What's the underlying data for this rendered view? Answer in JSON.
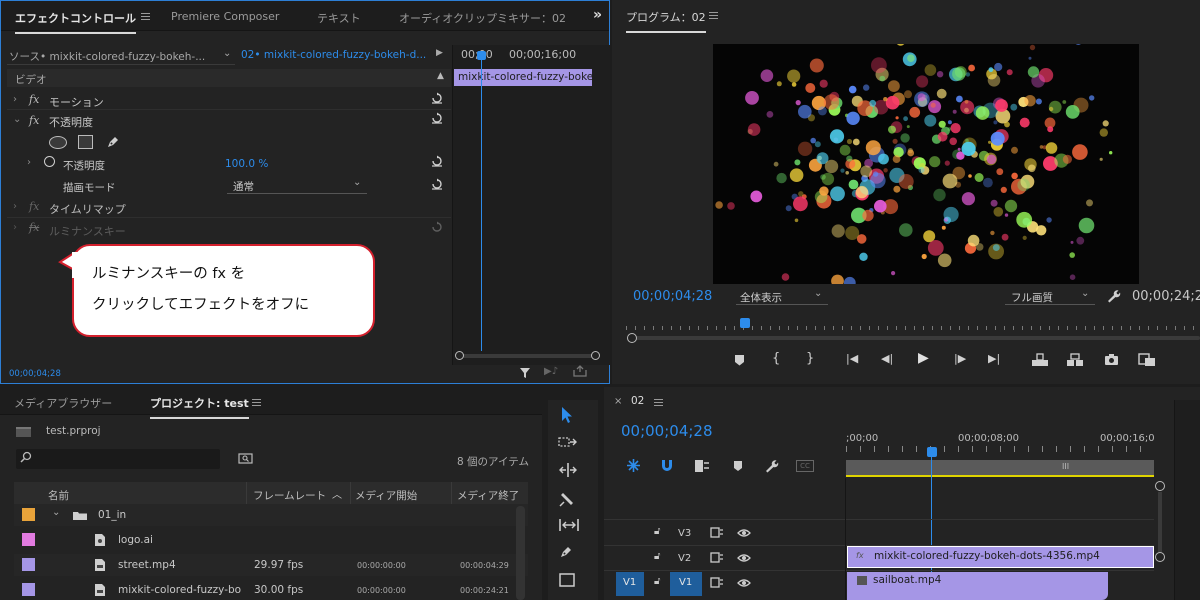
{
  "effect_controls": {
    "tabs": [
      "エフェクトコントロール",
      "Premiere Composer",
      "テキスト",
      "オーディオクリップミキサー：02"
    ],
    "source_label": "ソース• mixkit-colored-fuzzy-bokeh-...",
    "seq_label": "02• mixkit-colored-fuzzy-bokeh-d...",
    "ruler_t1": "00;00",
    "ruler_t2": "00;00;16;00",
    "clip_label": "mixkit-colored-fuzzy-boke",
    "section_video": "ビデオ",
    "effects": {
      "motion": "モーション",
      "opacity": "不透明度",
      "opacity_param": "不透明度",
      "opacity_value": "100.0 %",
      "blend_mode_label": "描画モード",
      "blend_mode_value": "通常",
      "time_remap": "タイムリマップ",
      "luma_key": "ルミナンスキー"
    },
    "timecode": "00;00;04;28"
  },
  "callout": {
    "line1": "ルミナンスキーの fx を",
    "line2": "クリックしてエフェクトをオフに"
  },
  "program": {
    "title": "プログラム：02",
    "timecode": "00;00;04;28",
    "zoom": "全体表示",
    "quality": "フル画質",
    "duration": "00;00;24;2"
  },
  "project": {
    "tabs": [
      "メディアブラウザー",
      "プロジェクト: test"
    ],
    "file": "test.prproj",
    "count": "8 個のアイテム",
    "columns": [
      "名前",
      "フレームレート",
      "メディア開始",
      "メディア終了"
    ],
    "rows": [
      {
        "name": "01_in",
        "fps": "",
        "start": "",
        "end": "",
        "color": "#e8a33a",
        "kind": "folder"
      },
      {
        "name": "logo.ai",
        "fps": "",
        "start": "",
        "end": "",
        "color": "#e27be0",
        "kind": "image"
      },
      {
        "name": "street.mp4",
        "fps": "29.97 fps",
        "start": "00:00:00:00",
        "end": "00:00:04:29",
        "color": "#a596e6",
        "kind": "video"
      },
      {
        "name": "mixkit-colored-fuzzy-bo",
        "fps": "30.00 fps",
        "start": "00:00:00:00",
        "end": "00:00:24:21",
        "color": "#a596e6",
        "kind": "video"
      }
    ]
  },
  "timeline": {
    "title": "02",
    "timecode": "00;00;04;28",
    "ruler": [
      ";00;00",
      "00;00;08;00",
      "00;00;16;0"
    ],
    "tracks": [
      {
        "patch": "",
        "name": "V3"
      },
      {
        "patch": "",
        "name": "V2"
      },
      {
        "patch": "V1",
        "name": "V1"
      }
    ],
    "clips": {
      "v2": "mixkit-colored-fuzzy-bokeh-dots-4356.mp4",
      "v1": "sailboat.mp4"
    }
  },
  "colors": {
    "accent": "#2d8ceb",
    "clip": "#a596e6",
    "callout_border": "#d4202d"
  }
}
